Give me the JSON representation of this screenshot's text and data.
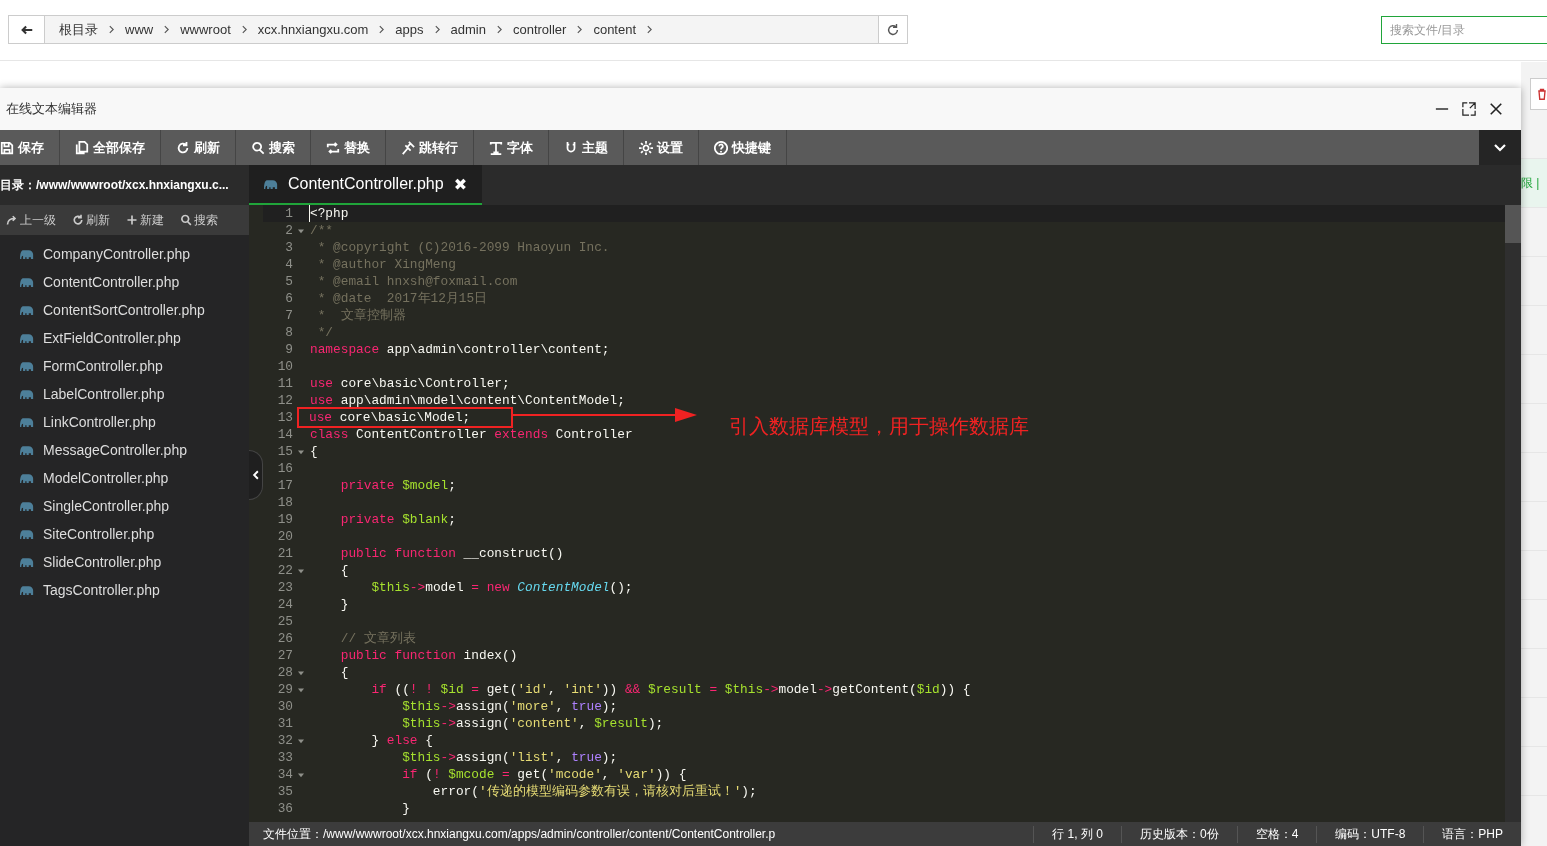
{
  "path_bar": {
    "crumbs": [
      "根目录",
      "www",
      "wwwroot",
      "xcx.hnxiangxu.com",
      "apps",
      "admin",
      "controller",
      "content"
    ]
  },
  "search": {
    "placeholder": "搜索文件/目录"
  },
  "background_table": {
    "cell_text": "限 |"
  },
  "editor_window": {
    "title": "在线文本编辑器",
    "toolbar": [
      {
        "kind": "save",
        "label": "保存"
      },
      {
        "kind": "saveall",
        "label": "全部保存"
      },
      {
        "kind": "refresh",
        "label": "刷新"
      },
      {
        "kind": "search",
        "label": "搜索"
      },
      {
        "kind": "replace",
        "label": "替换"
      },
      {
        "kind": "jump",
        "label": "跳转行"
      },
      {
        "kind": "font",
        "label": "字体"
      },
      {
        "kind": "theme",
        "label": "主题"
      },
      {
        "kind": "settings",
        "label": "设置"
      },
      {
        "kind": "help",
        "label": "快捷键"
      }
    ],
    "directory": "目录：/www/wwwroot/xcx.hnxiangxu.c...",
    "file_actions": [
      {
        "kind": "up",
        "label": "上一级"
      },
      {
        "kind": "refresh",
        "label": "刷新"
      },
      {
        "kind": "plus",
        "label": "新建"
      },
      {
        "kind": "search",
        "label": "搜索"
      }
    ],
    "files": [
      "CompanyController.php",
      "ContentController.php",
      "ContentSortController.php",
      "ExtFieldController.php",
      "FormController.php",
      "LabelController.php",
      "LinkController.php",
      "MessageController.php",
      "ModelController.php",
      "SingleController.php",
      "SiteController.php",
      "SlideController.php",
      "TagsController.php"
    ],
    "tabs": [
      {
        "label": "ContentController.php",
        "close": "✖",
        "selected": true
      }
    ],
    "code_lines": [
      {
        "number": "1",
        "active": true,
        "foldable": false,
        "highlighted": false,
        "tokens": [
          {
            "kind": "plain",
            "text": "<?php"
          }
        ]
      },
      {
        "number": "2",
        "active": false,
        "foldable": true,
        "highlighted": false,
        "tokens": [
          {
            "kind": "comment",
            "text": "/**"
          }
        ]
      },
      {
        "number": "3",
        "active": false,
        "foldable": false,
        "highlighted": false,
        "tokens": [
          {
            "kind": "comment",
            "text": " * @copyright (C)2016-2099 Hnaoyun Inc."
          }
        ]
      },
      {
        "number": "4",
        "active": false,
        "foldable": false,
        "highlighted": false,
        "tokens": [
          {
            "kind": "comment",
            "text": " * @author XingMeng"
          }
        ]
      },
      {
        "number": "5",
        "active": false,
        "foldable": false,
        "highlighted": false,
        "tokens": [
          {
            "kind": "comment",
            "text": " * @email hnxsh@foxmail.com"
          }
        ]
      },
      {
        "number": "6",
        "active": false,
        "foldable": false,
        "highlighted": false,
        "tokens": [
          {
            "kind": "comment",
            "text": " * @date  2017年12月15日"
          }
        ]
      },
      {
        "number": "7",
        "active": false,
        "foldable": false,
        "highlighted": false,
        "tokens": [
          {
            "kind": "comment",
            "text": " *  文章控制器"
          }
        ]
      },
      {
        "number": "8",
        "active": false,
        "foldable": false,
        "highlighted": false,
        "tokens": [
          {
            "kind": "comment",
            "text": " */"
          }
        ]
      },
      {
        "number": "9",
        "active": false,
        "foldable": false,
        "highlighted": false,
        "tokens": [
          {
            "kind": "keyword",
            "text": "namespace"
          },
          {
            "kind": "plain",
            "text": " app\\admin\\controller\\content;"
          }
        ]
      },
      {
        "number": "10",
        "active": false,
        "foldable": false,
        "highlighted": false
      },
      {
        "number": "11",
        "active": false,
        "foldable": false,
        "highlighted": false,
        "tokens": [
          {
            "kind": "keyword",
            "text": "use"
          },
          {
            "kind": "plain",
            "text": " core\\basic\\Controller;"
          }
        ]
      },
      {
        "number": "12",
        "active": false,
        "foldable": false,
        "highlighted": false,
        "tokens": [
          {
            "kind": "keyword",
            "text": "use"
          },
          {
            "kind": "plain",
            "text": " app\\admin\\model\\content\\ContentModel;"
          }
        ]
      },
      {
        "number": "13",
        "active": false,
        "foldable": false,
        "highlighted": true,
        "tokens": [
          {
            "kind": "keyword",
            "text": "use"
          },
          {
            "kind": "plain",
            "text": " core\\basic\\Model;"
          }
        ]
      },
      {
        "number": "14",
        "active": false,
        "foldable": false,
        "highlighted": false,
        "tokens": [
          {
            "kind": "keyword",
            "text": "class"
          },
          {
            "kind": "plain",
            "text": " ContentController "
          },
          {
            "kind": "keyword",
            "text": "extends"
          },
          {
            "kind": "plain",
            "text": " Controller"
          }
        ]
      },
      {
        "number": "15",
        "active": false,
        "foldable": true,
        "highlighted": false,
        "tokens": [
          {
            "kind": "plain",
            "text": "{"
          }
        ]
      },
      {
        "number": "16",
        "active": false,
        "foldable": false,
        "highlighted": false
      },
      {
        "number": "17",
        "active": false,
        "foldable": false,
        "highlighted": false,
        "tokens": [
          {
            "kind": "keyword",
            "text": "    private "
          },
          {
            "kind": "variable",
            "text": "$model"
          },
          {
            "kind": "plain",
            "text": ";"
          }
        ]
      },
      {
        "number": "18",
        "active": false,
        "foldable": false,
        "highlighted": false
      },
      {
        "number": "19",
        "active": false,
        "foldable": false,
        "highlighted": false,
        "tokens": [
          {
            "kind": "keyword",
            "text": "    private "
          },
          {
            "kind": "variable",
            "text": "$blank"
          },
          {
            "kind": "plain",
            "text": ";"
          }
        ]
      },
      {
        "number": "20",
        "active": false,
        "foldable": false,
        "highlighted": false
      },
      {
        "number": "21",
        "active": false,
        "foldable": false,
        "highlighted": false,
        "tokens": [
          {
            "kind": "keyword",
            "text": "    public function"
          },
          {
            "kind": "plain",
            "text": " __construct()"
          }
        ]
      },
      {
        "number": "22",
        "active": false,
        "foldable": true,
        "highlighted": false,
        "tokens": [
          {
            "kind": "plain",
            "text": "    {"
          }
        ]
      },
      {
        "number": "23",
        "active": false,
        "foldable": false,
        "highlighted": false,
        "tokens": [
          {
            "kind": "variable",
            "text": "        $this"
          },
          {
            "kind": "operator",
            "text": "->"
          },
          {
            "kind": "plain",
            "text": "model "
          },
          {
            "kind": "operator",
            "text": "= "
          },
          {
            "kind": "keyword",
            "text": "new "
          },
          {
            "kind": "class",
            "text": "ContentModel"
          },
          {
            "kind": "plain",
            "text": "();"
          }
        ]
      },
      {
        "number": "24",
        "active": false,
        "foldable": false,
        "highlighted": false,
        "tokens": [
          {
            "kind": "plain",
            "text": "    }"
          }
        ]
      },
      {
        "number": "25",
        "active": false,
        "foldable": false,
        "highlighted": false
      },
      {
        "number": "26",
        "active": false,
        "foldable": false,
        "highlighted": false,
        "tokens": [
          {
            "kind": "comment",
            "text": "    // 文章列表"
          }
        ]
      },
      {
        "number": "27",
        "active": false,
        "foldable": false,
        "highlighted": false,
        "tokens": [
          {
            "kind": "keyword",
            "text": "    public function"
          },
          {
            "kind": "plain",
            "text": " index()"
          }
        ]
      },
      {
        "number": "28",
        "active": false,
        "foldable": true,
        "highlighted": false,
        "tokens": [
          {
            "kind": "plain",
            "text": "    {"
          }
        ]
      },
      {
        "number": "29",
        "active": false,
        "foldable": true,
        "highlighted": false,
        "tokens": [
          {
            "kind": "keyword",
            "text": "        if"
          },
          {
            "kind": "plain",
            "text": " (("
          },
          {
            "kind": "operator",
            "text": "! ! "
          },
          {
            "kind": "variable",
            "text": "$id "
          },
          {
            "kind": "operator",
            "text": "="
          },
          {
            "kind": "plain",
            "text": " get("
          },
          {
            "kind": "string",
            "text": "'id'"
          },
          {
            "kind": "plain",
            "text": ", "
          },
          {
            "kind": "string",
            "text": "'int'"
          },
          {
            "kind": "plain",
            "text": ")) "
          },
          {
            "kind": "operator",
            "text": "&& "
          },
          {
            "kind": "variable",
            "text": "$result "
          },
          {
            "kind": "operator",
            "text": "= "
          },
          {
            "kind": "variable",
            "text": "$this"
          },
          {
            "kind": "operator",
            "text": "->"
          },
          {
            "kind": "plain",
            "text": "model"
          },
          {
            "kind": "operator",
            "text": "->"
          },
          {
            "kind": "plain",
            "text": "getContent("
          },
          {
            "kind": "variable",
            "text": "$id"
          },
          {
            "kind": "plain",
            "text": ")) {"
          }
        ]
      },
      {
        "number": "30",
        "active": false,
        "foldable": false,
        "highlighted": false,
        "tokens": [
          {
            "kind": "variable",
            "text": "            $this"
          },
          {
            "kind": "operator",
            "text": "->"
          },
          {
            "kind": "plain",
            "text": "assign("
          },
          {
            "kind": "string",
            "text": "'more'"
          },
          {
            "kind": "plain",
            "text": ", "
          },
          {
            "kind": "constant",
            "text": "true"
          },
          {
            "kind": "plain",
            "text": ");"
          }
        ]
      },
      {
        "number": "31",
        "active": false,
        "foldable": false,
        "highlighted": false,
        "tokens": [
          {
            "kind": "variable",
            "text": "            $this"
          },
          {
            "kind": "operator",
            "text": "->"
          },
          {
            "kind": "plain",
            "text": "assign("
          },
          {
            "kind": "string",
            "text": "'content'"
          },
          {
            "kind": "plain",
            "text": ", "
          },
          {
            "kind": "variable",
            "text": "$result"
          },
          {
            "kind": "plain",
            "text": ");"
          }
        ]
      },
      {
        "number": "32",
        "active": false,
        "foldable": true,
        "highlighted": false,
        "tokens": [
          {
            "kind": "plain",
            "text": "        } "
          },
          {
            "kind": "keyword",
            "text": "else"
          },
          {
            "kind": "plain",
            "text": " {"
          }
        ]
      },
      {
        "number": "33",
        "active": false,
        "foldable": false,
        "highlighted": false,
        "tokens": [
          {
            "kind": "variable",
            "text": "            $this"
          },
          {
            "kind": "operator",
            "text": "->"
          },
          {
            "kind": "plain",
            "text": "assign("
          },
          {
            "kind": "string",
            "text": "'list'"
          },
          {
            "kind": "plain",
            "text": ", "
          },
          {
            "kind": "constant",
            "text": "true"
          },
          {
            "kind": "plain",
            "text": ");"
          }
        ]
      },
      {
        "number": "34",
        "active": false,
        "foldable": true,
        "highlighted": false,
        "tokens": [
          {
            "kind": "keyword",
            "text": "            if"
          },
          {
            "kind": "plain",
            "text": " ("
          },
          {
            "kind": "operator",
            "text": "! "
          },
          {
            "kind": "variable",
            "text": "$mcode "
          },
          {
            "kind": "operator",
            "text": "="
          },
          {
            "kind": "plain",
            "text": " get("
          },
          {
            "kind": "string",
            "text": "'mcode'"
          },
          {
            "kind": "plain",
            "text": ", "
          },
          {
            "kind": "string",
            "text": "'var'"
          },
          {
            "kind": "plain",
            "text": ")) {"
          }
        ]
      },
      {
        "number": "35",
        "active": false,
        "foldable": false,
        "highlighted": false,
        "tokens": [
          {
            "kind": "plain",
            "text": "                error("
          },
          {
            "kind": "string",
            "text": "'传递的模型编码参数有误，请核对后重试！'"
          },
          {
            "kind": "plain",
            "text": ");"
          }
        ]
      },
      {
        "number": "36",
        "active": false,
        "foldable": false,
        "highlighted": false,
        "tokens": [
          {
            "kind": "plain",
            "text": "            }"
          }
        ]
      }
    ],
    "annotation": {
      "text": "引入数据库模型，用于操作数据库"
    },
    "status_bar": [
      "文件位置：/www/wwwroot/xcx.hnxiangxu.com/apps/admin/controller/content/ContentController.p",
      "行 1, 列 0",
      "历史版本：0份",
      "空格：4",
      "编码：UTF-8",
      "语言：PHP"
    ]
  }
}
